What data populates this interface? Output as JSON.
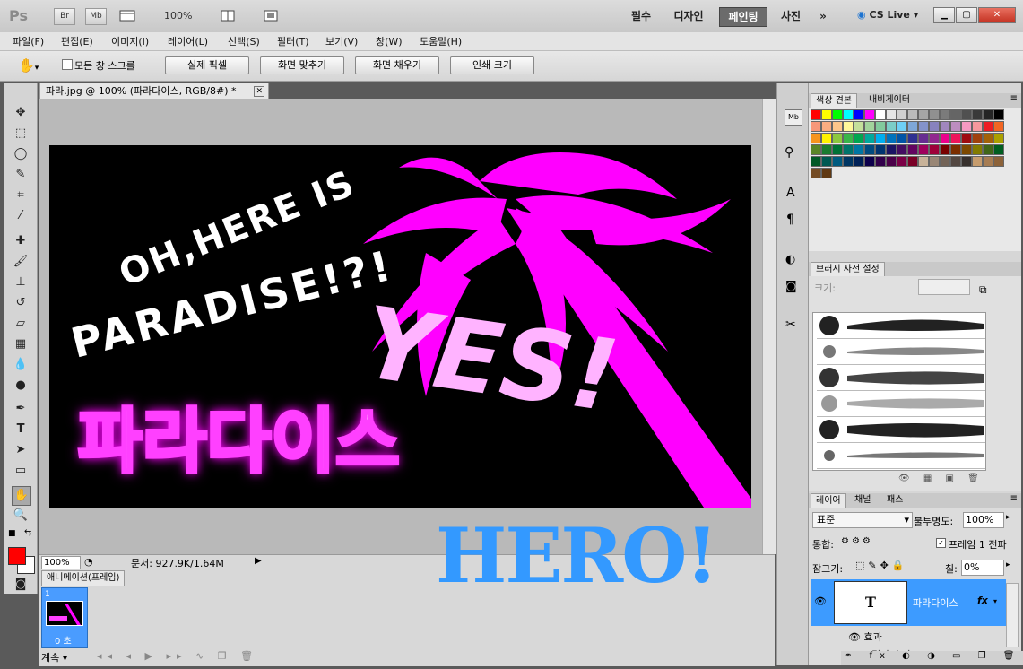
{
  "app": {
    "logo": "Ps",
    "bar_buttons": [
      "Br",
      "Mb"
    ],
    "zoom": "100%",
    "workspaces": [
      "필수",
      "디자인",
      "페인팅",
      "사진"
    ],
    "active_workspace": "페인팅",
    "more": "»",
    "cs_live": "CS Live"
  },
  "menu": [
    "파일(F)",
    "편집(E)",
    "이미지(I)",
    "레이어(L)",
    "선택(S)",
    "필터(T)",
    "보기(V)",
    "창(W)",
    "도움말(H)"
  ],
  "options": {
    "all_windows": "모든 창 스크롤",
    "buttons": [
      "실제 픽셀",
      "화면 맞추기",
      "화면 채우기",
      "인쇄 크기"
    ]
  },
  "document": {
    "tab_title": "파라.jpg @ 100% (파라다이스, RGB/8#) *",
    "art": {
      "line1": "OH,HERE IS",
      "line2": "PARADISE!?!",
      "yes": "YES!",
      "korean": "파라다이스"
    },
    "zoom": "100%",
    "doc_size": "문서: 927.9K/1.64M"
  },
  "overlay_text": "HERO!",
  "animation": {
    "title": "애니메이션(프레임)",
    "frame_number": "1",
    "frame_delay": "0 초",
    "loop": "계속"
  },
  "swatches_panel": {
    "tabs": [
      "색상 견본",
      "내비게이터"
    ]
  },
  "brush_panel": {
    "title": "브러시 사전 설정",
    "size_label": "크기:"
  },
  "layers_panel": {
    "tabs": [
      "레이어",
      "채널",
      "패스"
    ],
    "blend_mode": "표준",
    "opacity_label": "불투명도:",
    "opacity": "100%",
    "unify_label": "통합:",
    "propagate": "프레임 1 전파",
    "lock_label": "잠그기:",
    "fill_label": "칠:",
    "fill": "0%",
    "layer_name": "파라다이스",
    "layer_thumb": "T",
    "fx": "fx",
    "effects": "효과",
    "effect_sub": "그림자 효과"
  },
  "colors": {
    "magenta": "#ff00ff",
    "pink": "#ffb3ff",
    "hero_blue": "#3399ff",
    "fg": "#ff0000",
    "layer_sel": "#3d9bff"
  }
}
